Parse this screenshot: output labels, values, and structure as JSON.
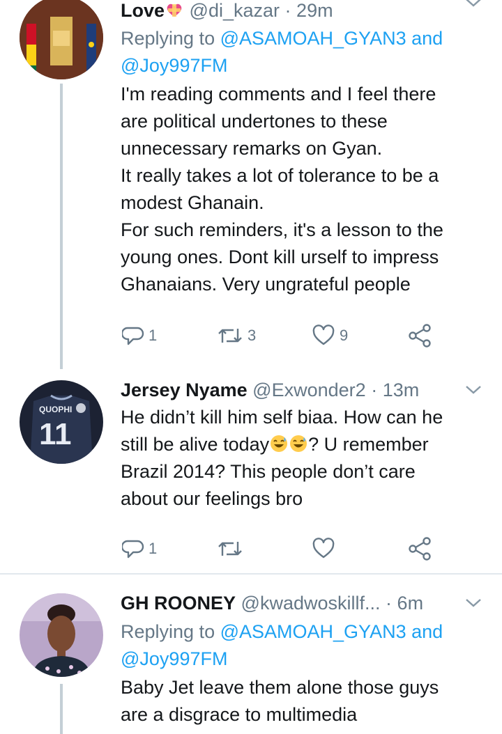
{
  "tweets": [
    {
      "name": "Love",
      "handle": "@di_kazar",
      "separator": "·",
      "time": "29m",
      "reply_prefix": "Replying to",
      "reply_mentions": "@ASAMOAH_GYAN3 and",
      "reply_mentions_2": "@Joy997FM",
      "body_lines": [
        "I'm reading comments and I feel there",
        "are political undertones to these",
        "unnecessary remarks on Gyan.",
        "It really takes a lot of tolerance to be a",
        "modest Ghanain.",
        "For such reminders, it's a lesson to the",
        "young ones. Dont kill urself to impress",
        "Ghanaians. Very ungrateful people"
      ],
      "replies": "1",
      "retweets": "3",
      "likes": "9"
    },
    {
      "name": "Jersey Nyame",
      "handle": "@Exwonder2",
      "separator": "·",
      "time": "13m",
      "body_lines": [
        "He didn’t kill him self biaa. How can he",
        "still be alive today",
        "? U remember",
        "Brazil 2014? This people don’t care",
        "about our feelings bro"
      ],
      "replies": "1",
      "jersey_text": "QUOPHI",
      "jersey_number": "11"
    },
    {
      "name": "GH ROONEY",
      "handle": "@kwadwoskillf...",
      "separator": "·",
      "time": "6m",
      "reply_prefix": "Replying to",
      "reply_mentions": "@ASAMOAH_GYAN3 and",
      "reply_mentions_2": "@Joy997FM",
      "body_lines": [
        "Baby Jet leave them alone those guys",
        "are a disgrace to multimedia"
      ]
    }
  ],
  "icons": {
    "reply": "reply-icon",
    "retweet": "retweet-icon",
    "like": "heart-icon",
    "share": "share-icon",
    "caret": "chevron-down-icon",
    "emoji_heart": "sparkling-heart-emoji",
    "emoji_laugh": "grinning-sweat-emoji"
  },
  "colors": {
    "link": "#1da1f2",
    "secondary": "#657786",
    "text": "#14171a",
    "divider": "#e1e8ed"
  }
}
